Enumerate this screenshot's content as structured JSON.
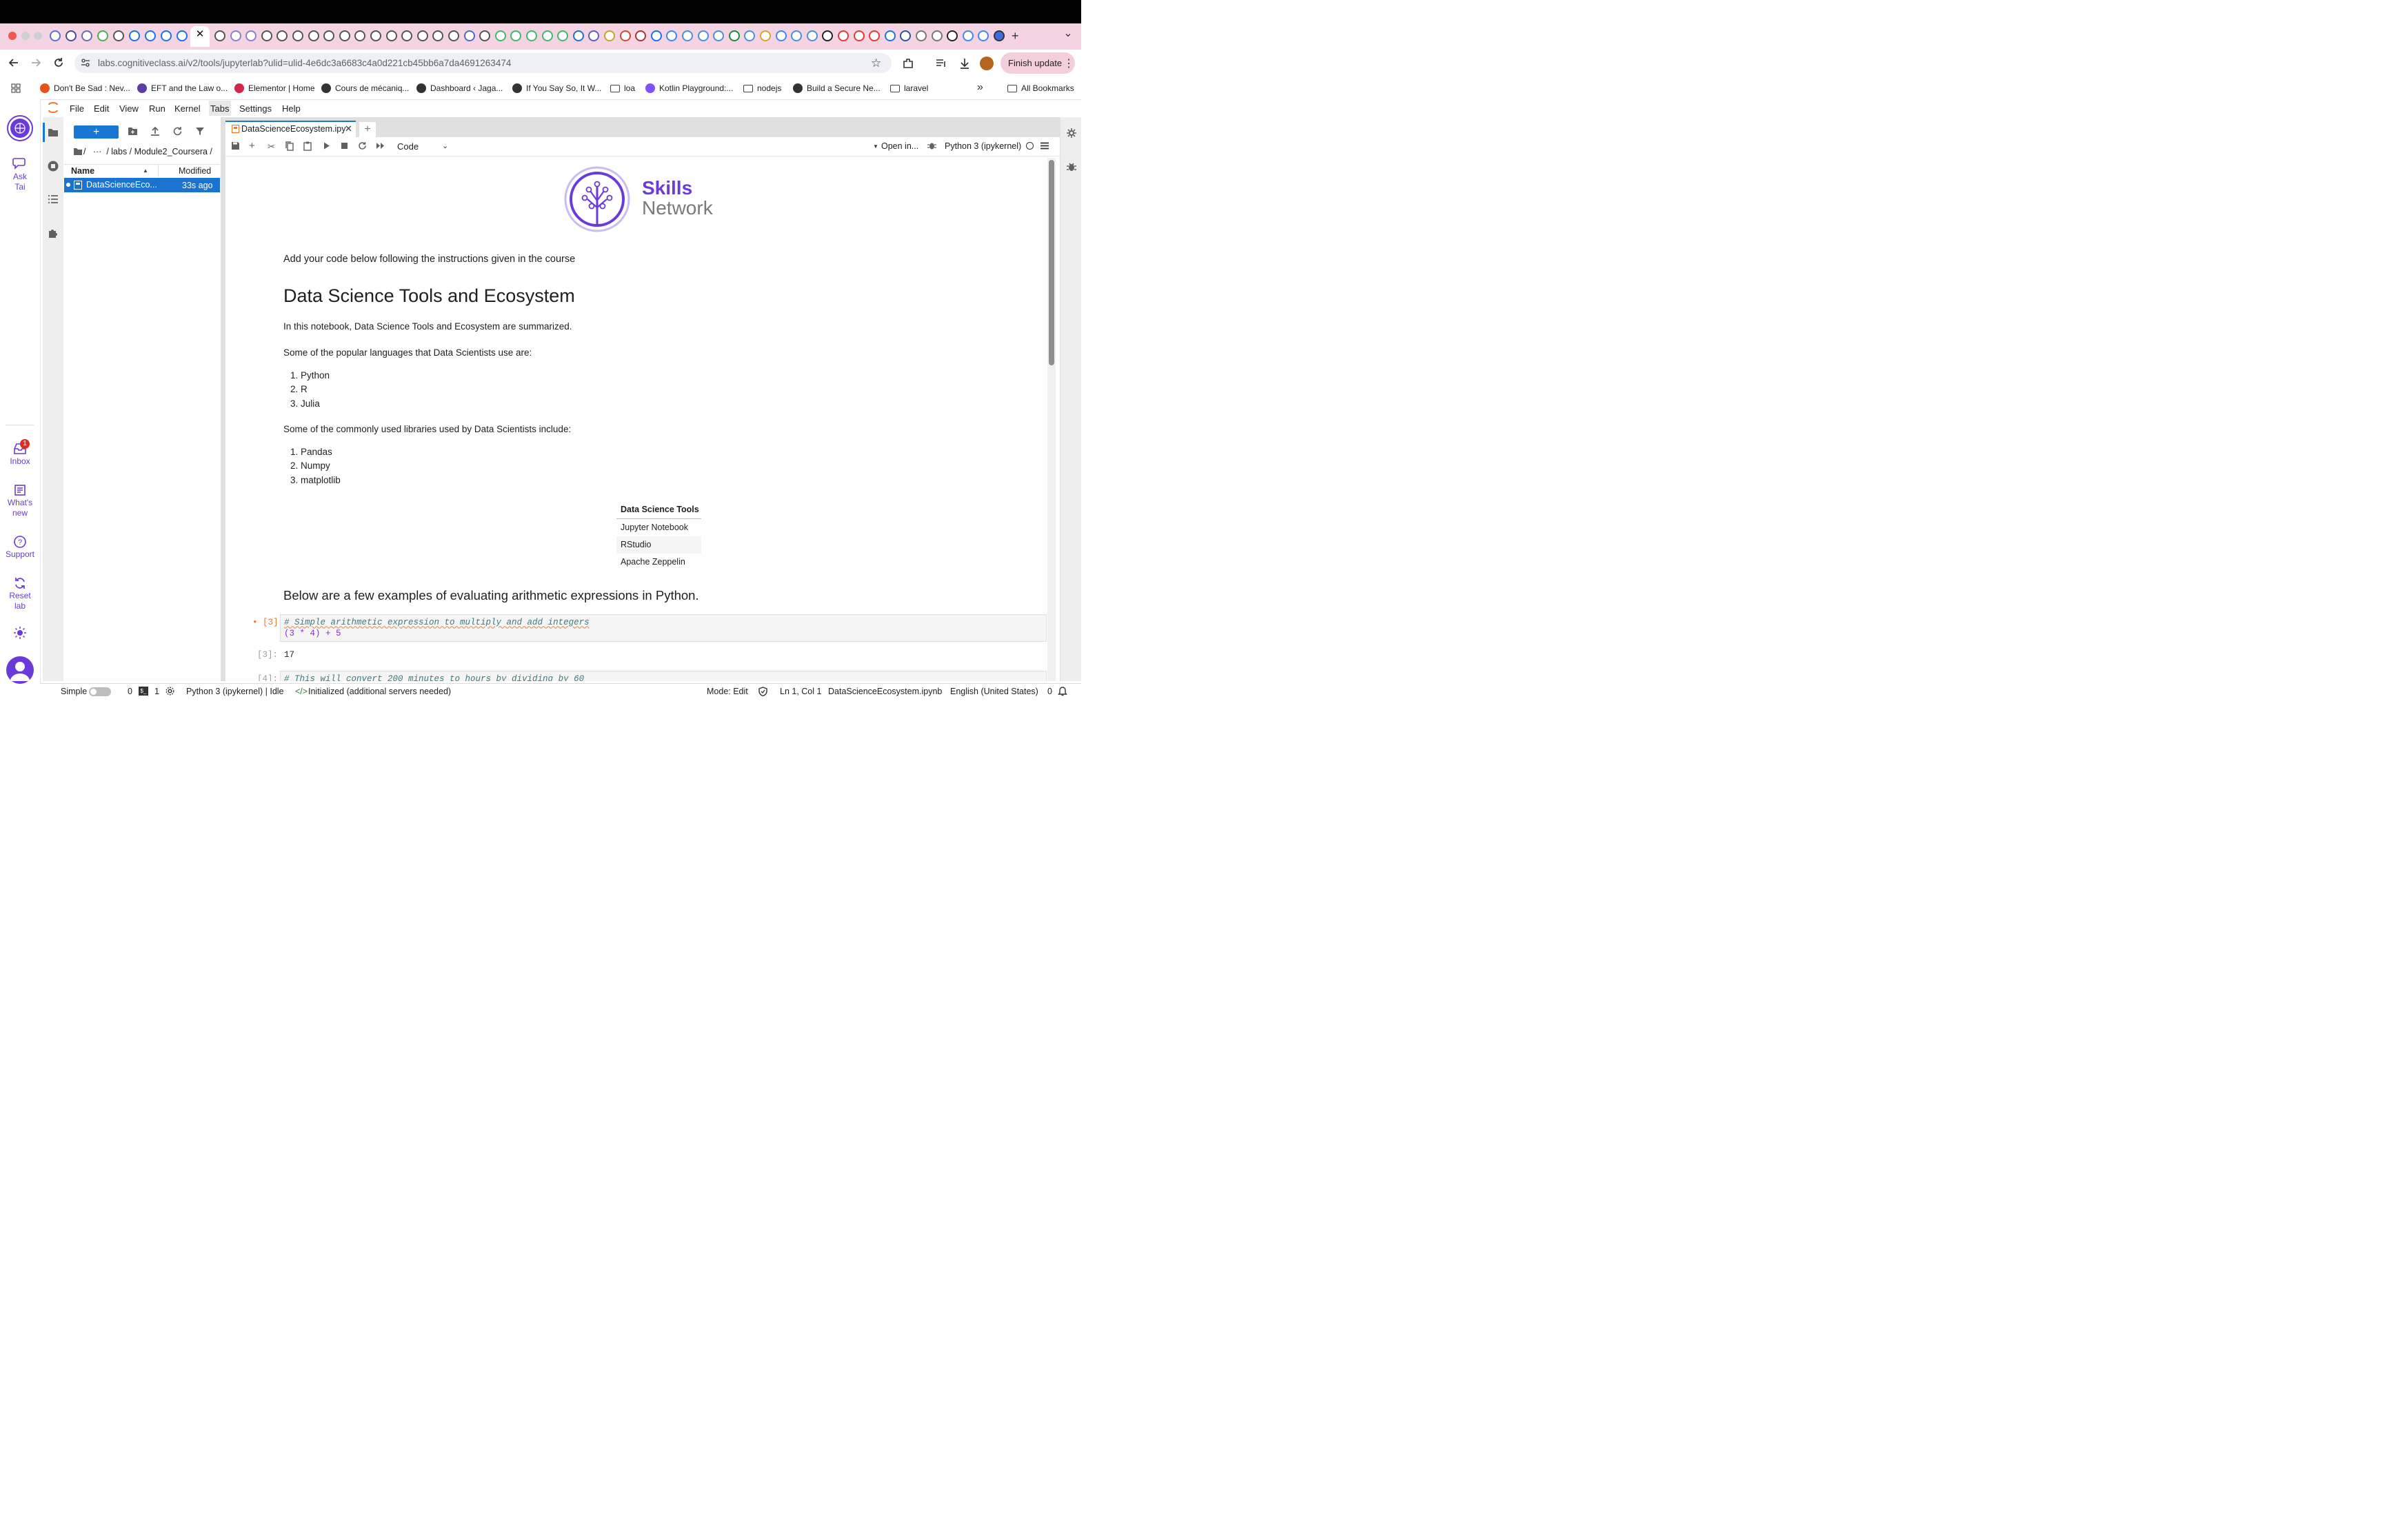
{
  "browser": {
    "new_tab_symbol": "+",
    "url": "labs.cognitiveclass.ai/v2/tools/jupyterlab?ulid=ulid-4e6dc3a6683c4a0d221cb45bb6a7da4691263474",
    "finish_update_label": "Finish update",
    "more_symbol": "⋮",
    "expand_symbol": "⌄"
  },
  "bookmarks": [
    {
      "label": "Don't Be Sad : Nev...",
      "color": "#e8531a"
    },
    {
      "label": "EFT and the Law o...",
      "color": "#5b3fa6"
    },
    {
      "label": "Elementor | Home",
      "color": "#d3264b"
    },
    {
      "label": "Cours de mécaniq...",
      "color": "#333333"
    },
    {
      "label": "Dashboard ‹ Jaga...",
      "color": "#333333"
    },
    {
      "label": "If You Say So, It W...",
      "color": "#333333"
    },
    {
      "label": "loa",
      "folder": true
    },
    {
      "label": "Kotlin Playground:...",
      "color": "#7f52ff"
    },
    {
      "label": "nodejs",
      "folder": true
    },
    {
      "label": "Build a Secure Ne...",
      "color": "#333333"
    },
    {
      "label": "laravel",
      "folder": true
    }
  ],
  "bookmarks_overflow": "»",
  "all_bookmarks_label": "All Bookmarks",
  "rail": {
    "ask": [
      "Ask",
      "Tai"
    ],
    "inbox": "Inbox",
    "inbox_badge": "1",
    "whats_new": [
      "What's",
      "new"
    ],
    "support": "Support",
    "reset": [
      "Reset",
      "lab"
    ]
  },
  "menu": [
    "File",
    "Edit",
    "View",
    "Run",
    "Kernel",
    "Tabs",
    "Settings",
    "Help"
  ],
  "filebrowser": {
    "new_label": "+",
    "breadcrumb": "/   ···  / labs / Module2_Coursera /",
    "col_name": "Name",
    "col_modified": "Modified",
    "file_name": "DataScienceEco...",
    "file_modified": "33s ago"
  },
  "doctab": {
    "title": "DataScienceEcosystem.ipy",
    "close": "✕",
    "add": "+"
  },
  "nbtoolbar": {
    "cell_type": "Code",
    "open_in": "Open in...",
    "kernel": "Python 3 (ipykernel)"
  },
  "logo": {
    "line1": "Skills",
    "line2": "Network"
  },
  "notebook": {
    "intro": "Add your code below following the instructions given in the course",
    "title": "Data Science Tools and Ecosystem",
    "summary": "In this notebook, Data Science Tools and Ecosystem are summarized.",
    "languages_intro": "Some of the popular languages that Data Scientists use are:",
    "languages": [
      "Python",
      "R",
      "Julia"
    ],
    "libraries_intro": "Some of the commonly used libraries used by Data Scientists include:",
    "libraries": [
      "Pandas",
      "Numpy",
      "matplotlib"
    ],
    "table_header": "Data Science Tools",
    "table_rows": [
      "Jupyter Notebook",
      "RStudio",
      "Apache Zeppelin"
    ],
    "arith_heading": "Below are a few examples of evaluating arithmetic expressions in Python.",
    "cell3_prompt": "• [3]:",
    "cell3_comment": "# Simple arithmetic expression to multiply and add integers",
    "cell3_code": "(3 * 4) + 5",
    "out3_prompt": "[3]:",
    "out3_value": "17",
    "cell4_prompt": "[4]:",
    "cell4_comment": "# This will convert 200 minutes to hours by dividing by 60"
  },
  "status": {
    "simple": "Simple",
    "zero": "0",
    "one": "1",
    "kernel_status": "Python 3 (ipykernel) | Idle",
    "lsp": "Initialized (additional servers needed)",
    "mode": "Mode: Edit",
    "position": "Ln 1, Col 1",
    "filename": "DataScienceEcosystem.ipynb",
    "language": "English (United States)",
    "notifications": "0"
  }
}
